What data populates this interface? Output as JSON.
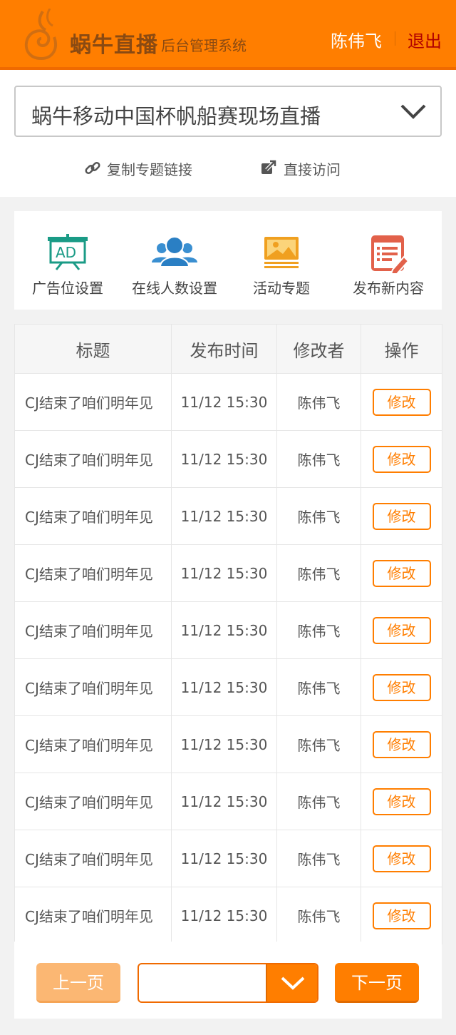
{
  "header": {
    "brand": "蜗牛直播",
    "subtitle": "后台管理系统",
    "user": "陈伟飞",
    "logout": "退出",
    "accent_color": "#ff7e00",
    "logout_color": "#b10000"
  },
  "topic_select": {
    "selected": "蜗牛移动中国杯帆船赛现场直播"
  },
  "links": {
    "copy_link": "复制专题链接",
    "visit": "直接访问"
  },
  "actions": [
    {
      "label": "广告位设置",
      "icon": "ad-board-icon"
    },
    {
      "label": "在线人数设置",
      "icon": "users-icon"
    },
    {
      "label": "活动专题",
      "icon": "image-icon"
    },
    {
      "label": "发布新内容",
      "icon": "edit-document-icon"
    }
  ],
  "table": {
    "headers": [
      "标题",
      "发布时间",
      "修改者",
      "操作"
    ],
    "rows": [
      {
        "title": "CJ结束了咱们明年见",
        "time": "11/12 15:30",
        "editor": "陈伟飞",
        "action": "修改"
      },
      {
        "title": "CJ结束了咱们明年见",
        "time": "11/12 15:30",
        "editor": "陈伟飞",
        "action": "修改"
      },
      {
        "title": "CJ结束了咱们明年见",
        "time": "11/12 15:30",
        "editor": "陈伟飞",
        "action": "修改"
      },
      {
        "title": "CJ结束了咱们明年见",
        "time": "11/12 15:30",
        "editor": "陈伟飞",
        "action": "修改"
      },
      {
        "title": "CJ结束了咱们明年见",
        "time": "11/12 15:30",
        "editor": "陈伟飞",
        "action": "修改"
      },
      {
        "title": "CJ结束了咱们明年见",
        "time": "11/12 15:30",
        "editor": "陈伟飞",
        "action": "修改"
      },
      {
        "title": "CJ结束了咱们明年见",
        "time": "11/12 15:30",
        "editor": "陈伟飞",
        "action": "修改"
      },
      {
        "title": "CJ结束了咱们明年见",
        "time": "11/12 15:30",
        "editor": "陈伟飞",
        "action": "修改"
      },
      {
        "title": "CJ结束了咱们明年见",
        "time": "11/12 15:30",
        "editor": "陈伟飞",
        "action": "修改"
      },
      {
        "title": "CJ结束了咱们明年见",
        "time": "11/12 15:30",
        "editor": "陈伟飞",
        "action": "修改"
      }
    ]
  },
  "pager": {
    "prev": "上一页",
    "next": "下一页",
    "page_value": ""
  }
}
